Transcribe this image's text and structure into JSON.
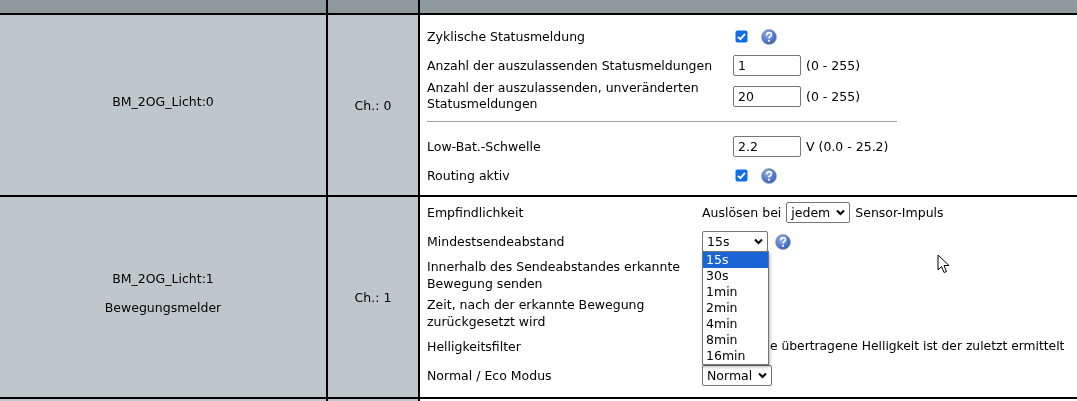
{
  "channels": [
    {
      "name": "BM_2OG_Licht:0",
      "channel": "Ch.: 0",
      "params": [
        {
          "kind": "checkbox",
          "label": "Zyklische Statusmeldung",
          "checked": true,
          "help": true
        },
        {
          "kind": "number",
          "label": "Anzahl der auszulassenden Statusmeldungen",
          "value": "1",
          "suffix": "(0 - 255)"
        },
        {
          "kind": "number",
          "label": "Anzahl der auszulassenden, unveränderten Statusmeldungen",
          "value": "20",
          "suffix": "(0 - 255)"
        },
        {
          "kind": "divider"
        },
        {
          "kind": "number",
          "label": "Low-Bat.-Schwelle",
          "value": "2.2",
          "suffix": "V (0.0 - 25.2)"
        },
        {
          "kind": "checkbox",
          "label": "Routing aktiv",
          "checked": true,
          "help": true
        }
      ]
    },
    {
      "name": "BM_2OG_Licht:1",
      "type": "Bewegungsmelder",
      "channel": "Ch.: 1",
      "params": [
        {
          "kind": "select",
          "label": "Empfindlichkeit",
          "prefix": "Auslösen bei",
          "value": "jedem",
          "suffix": "Sensor-Impuls"
        },
        {
          "kind": "select",
          "label": "Mindestsendeabstand",
          "value": "15s",
          "help": true,
          "expanded": true,
          "options": [
            {
              "label": "15s",
              "selected": true
            },
            {
              "label": "30s",
              "selected": false
            },
            {
              "label": "1min",
              "selected": false
            },
            {
              "label": "2min",
              "selected": false
            },
            {
              "label": "4min",
              "selected": false
            },
            {
              "label": "8min",
              "selected": false
            },
            {
              "label": "16min",
              "selected": false
            }
          ]
        },
        {
          "kind": "label",
          "label": "Innerhalb des Sendeabstandes erkannte Bewegung senden"
        },
        {
          "kind": "label",
          "label": "Zeit, nach der erkannte Bewegung zurückgesetzt wird"
        },
        {
          "kind": "text",
          "label": "Helligkeitsfilter",
          "text": "e übertragene Helligkeit ist der zuletzt ermittelt"
        },
        {
          "kind": "select",
          "label": "Normal / Eco Modus",
          "value": "Normal"
        }
      ]
    }
  ]
}
